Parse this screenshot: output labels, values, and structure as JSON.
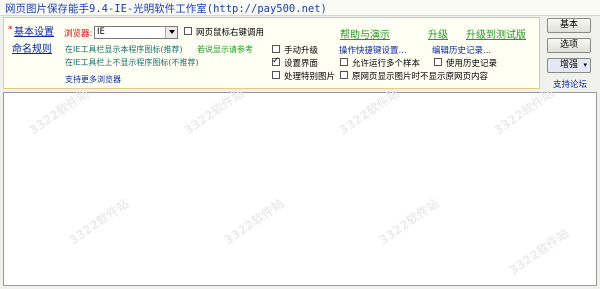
{
  "window": {
    "title": "网页图片保存能手9.4-IE-光明软件工作室(http://pay500.net)"
  },
  "nav": {
    "basic_settings": "基本设置",
    "naming_rules": "命名规则"
  },
  "browser": {
    "label": "浏览器:",
    "selected": "IE"
  },
  "options": {
    "right_click": "网页鼠标右键调用",
    "toolbar_show_icon": "在IE工具栏显示本程序图标(推荐)",
    "toolbar_hide_icon": "在IE工具栏上不显示程序图标(不推荐)",
    "display_reference": "若说显示请参考",
    "more_browsers": "支持更多浏览器"
  },
  "checkboxes": [
    {
      "label": "手动升级",
      "checked": false
    },
    {
      "label": "设置界面",
      "checked": true
    },
    {
      "label": "处理特别图片",
      "checked": false
    },
    {
      "label": "允许运行多个样本",
      "checked": false
    },
    {
      "label": "原网页显示图片时不显示原网页内容",
      "checked": false
    },
    {
      "label": "使用历史记录",
      "checked": false
    }
  ],
  "links": {
    "help": "帮助与演示",
    "upgrade": "升级",
    "upgrade_test": "升级到测试版",
    "hotkeys": "操作快捷键设置...",
    "edit_history": "编辑历史记录...",
    "support_forum": "支持论坛"
  },
  "buttons": {
    "basic": "基本",
    "options": "选项",
    "enhance": "增强"
  },
  "watermarks": [
    "3322软件站",
    "3322软件站",
    "3322软件站",
    "3322软件站",
    "3322软件站",
    "3322软件站",
    "3322软件站",
    "3322软件站"
  ]
}
